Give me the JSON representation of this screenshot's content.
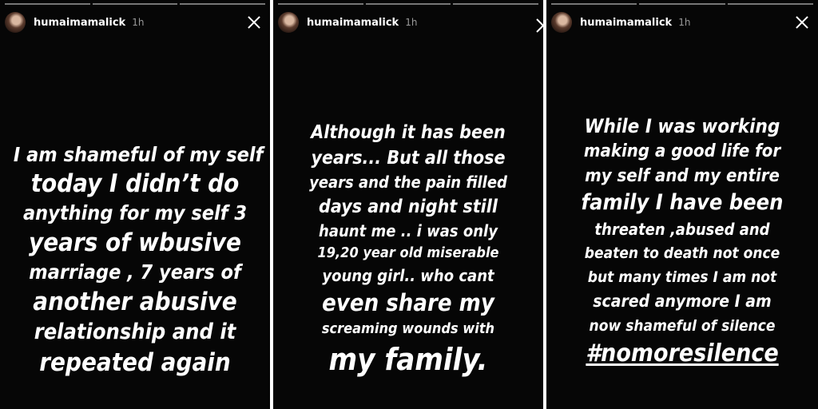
{
  "panels": [
    {
      "username": "humaimamalick",
      "time": "1h",
      "lines": [
        "I am shameful of my self",
        "today I didn’t do",
        "anything for my self 3",
        "years of wbusive",
        "marriage , 7 years of",
        "another abusive",
        "relationship and it",
        "repeated again"
      ]
    },
    {
      "username": "humaimamalick",
      "time": "1h",
      "lines": [
        "Although it has been",
        "years... But all those",
        "years and the pain filled",
        "days and night still",
        "haunt me .. i was only",
        "19,20  year old miserable",
        "young girl.. who cant",
        "even share my",
        "screaming wounds with",
        "my family."
      ]
    },
    {
      "username": "humaimamalick",
      "time": "1h",
      "lines": [
        "While I was working",
        "making a good life for",
        "my self and my entire",
        "family I have been",
        "threaten ,abused and",
        "beaten to death not once",
        "but many times I am not",
        "scared anymore I am",
        "now shameful of silence",
        "#nomoresilence"
      ]
    }
  ]
}
